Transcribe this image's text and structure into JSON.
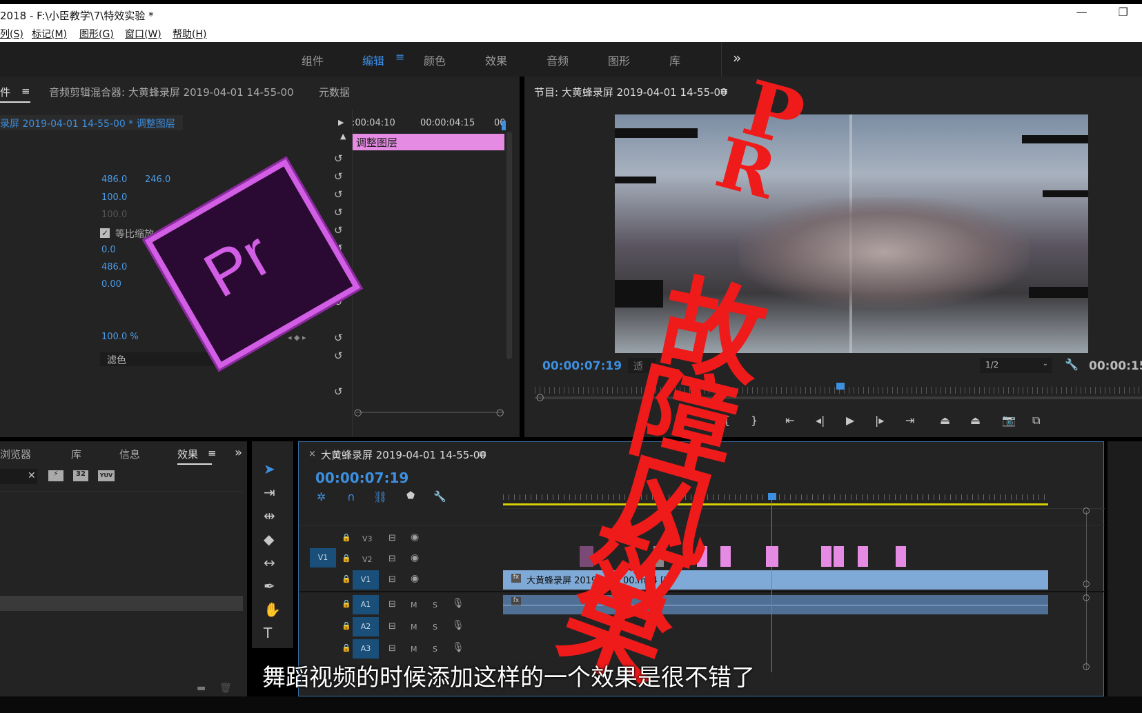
{
  "title_bar": {
    "title": "2018 - F:\\小臣教学\\7\\特效实验 *",
    "minimize": "—",
    "restore": "❐"
  },
  "menu": [
    "列(S)",
    "标记(M)",
    "图形(G)",
    "窗口(W)",
    "帮助(H)"
  ],
  "workspaces": {
    "items": [
      "组件",
      "编辑",
      "颜色",
      "效果",
      "音频",
      "图形",
      "库"
    ],
    "active": "编辑",
    "more": "»",
    "menu_icon": "≡"
  },
  "effect_controls": {
    "tab_partial": "件",
    "tab_menu": "≡",
    "tab_mixer": "音频剪辑混合器: 大黄蜂录屏 2019-04-01 14-55-00",
    "tab_meta": "元数据",
    "clip_path": "录屏 2019-04-01 14-55-00 * 调整图层",
    "timecode_a": ":00:04:10",
    "timecode_b": "00:00:04:15",
    "timecode_c": "00",
    "clip_label": "调整图层",
    "position_x": "486.0",
    "position_y": "246.0",
    "scale": "100.0",
    "scale_width": "100.0",
    "uniform_scale": "等比缩放",
    "rotation": "0.0",
    "anchor": "486.0",
    "anti_flicker": "0.00",
    "opacity": "100.0 %",
    "blend_mode": "滤色"
  },
  "program_monitor": {
    "title": "节目: 大黄蜂录屏 2019-04-01 14-55-00",
    "menu": "≡",
    "timecode": "00:00:07:19",
    "fit": "适",
    "resolution": "1/2",
    "duration": "00:00:15"
  },
  "project_panel": {
    "tabs": [
      "浏览器",
      "库",
      "信息",
      "效果"
    ],
    "active": "效果",
    "menu": "≡",
    "more": "»",
    "clear": "✕",
    "badges": [
      "32",
      "YUV"
    ]
  },
  "timeline": {
    "close": "×",
    "title": "大黄蜂录屏 2019-04-01 14-55-00",
    "menu": "≡",
    "timecode": "00:00:07:19",
    "tracks_video": [
      "V3",
      "V2",
      "V1"
    ],
    "tracks_audio": [
      "A1",
      "A2",
      "A3"
    ],
    "source_patch": "V1",
    "mute": "M",
    "solo": "S",
    "clip_v1": "大黄蜂录屏 2019-0 14  00.mp4 [V]",
    "fx": "fx"
  },
  "overlay": {
    "pr_logo": "Pr",
    "side_title": [
      "P",
      "R"
    ],
    "big_title": [
      "故",
      "障",
      "风",
      "效",
      "果"
    ]
  },
  "subtitle": "舞蹈视频的时候添加这样的一个效果是很不错了"
}
